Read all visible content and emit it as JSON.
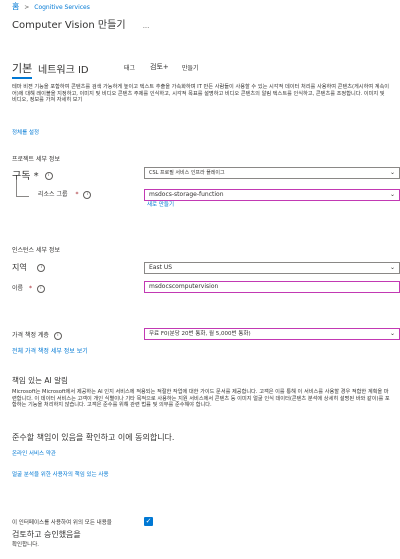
{
  "breadcrumb": {
    "home": "홈",
    "sep": ">",
    "service": "Cognitive Services"
  },
  "page": {
    "title": "Computer Vision 만들기",
    "more": "..."
  },
  "tabs": [
    {
      "label": "기본",
      "active": true
    },
    {
      "label": "네트워크 ID"
    },
    {
      "label": "태그"
    },
    {
      "label": "검토+"
    },
    {
      "label": "만들기"
    }
  ],
  "intro": "테마 비젼 기능을 포함하여 콘텐츠를 검색 가능하게 높이고 텍스트 추출을 가속화하며 IT 만든 사람들이 사용할 수 있는 시각적 데이터 처리를 사용하여 콘텐츠(게시하여 계속이어)에 대해 레이블을 지정하고, 이미지 및 비디오 콘텐츠 주제를 인식하고, 시각적 목표를 설명하고 비디오 콘텐츠의 알림 텍스트를 인식하고, 콘텐츠를 조정합니다. 이미지 및 비디오, 정보를 가져 자세히 보기",
  "learn_more": "정체를 설정",
  "project": {
    "section": "프로젝트 세부 정보",
    "subscription_label": "구독 *",
    "subscription_value": "CSL 프로필 서비스 인프라 플레이그",
    "rg_label": "리소스 그룹",
    "rg_value": "msdocs-storage-function",
    "rg_create": "새로 만들기"
  },
  "instance": {
    "section": "인스턴스 세부 정보",
    "region_label": "지역",
    "region_value": "East US",
    "name_label": "이름",
    "name_value": "msdocscomputervision"
  },
  "pricing": {
    "label": "가격 책정 계층",
    "value": "무료 F0(분당 20번 통화, 월 5,000번 통화)",
    "view_full": "전체 가격 책정 세부 정보 보기"
  },
  "responsible_ai": {
    "heading": "책임 있는 AI 알림",
    "body": "Microsoft는 Microsoft에서 제공하는 AI 인지 서비스에 적용되는 적절한 작업에 대한 가이드 문서를 제공합니다. 고객은 이를 통해 이 서비스를 사용할 경우 적합한 계획을 마련합니다. 이 데이터 서비스는 고객이 개인 식별이나 기타 목적으로 사용하는 지원 서비스에서 콘텐츠 등 이미지 얼굴 인식 데이터(콘텐츠 분석에 상세히 설명된 바와 같이)를 포함하는 기능을 처리하지 않습니다. 고객은 준수를 위해 관련 법률 및 의무를 준수해야 합니다.",
    "big_line": "준수할 책임이 있음을 확인하고 이에 동의합니다.",
    "link1": "온라인 서비스 약관",
    "link2": "얼굴 분석을 위한 사용자의 책임 있는 사용"
  },
  "ack": {
    "line1": "이 인터페이스를 사용하여 위의 모든 내용을",
    "line2": "검토하고 승인했음을",
    "line3": "확인합니다.",
    "checked": true
  },
  "colors": {
    "accent": "#0078d4",
    "highlight": "#c239b3",
    "required": "#a4262c"
  }
}
